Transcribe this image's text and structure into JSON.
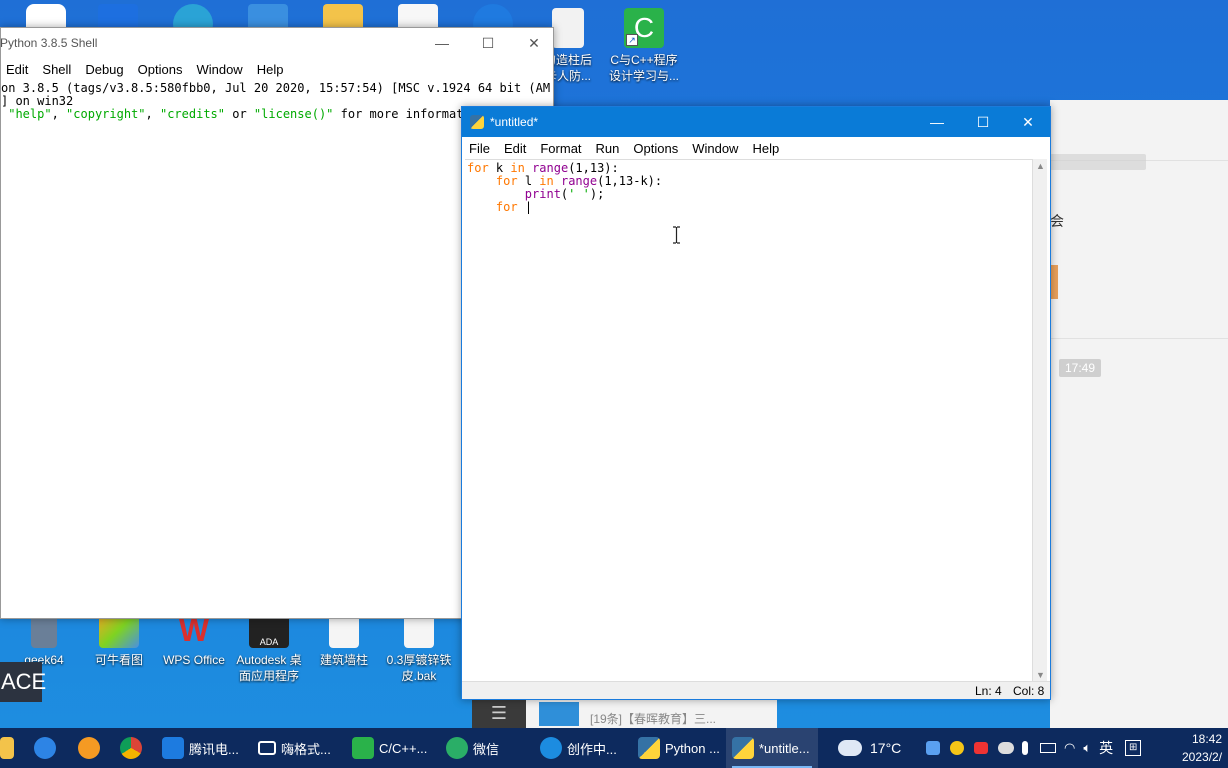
{
  "desktop": {
    "icons": [
      {
        "label": "勾造柱后",
        "label2": "卡人防...",
        "color": "#f2f2f2"
      },
      {
        "label": "C与C++程序",
        "label2": "设计学习与...",
        "color": "#2ab24a",
        "glyph": "C"
      },
      {
        "label": "geek64",
        "color": "#6a7f98"
      },
      {
        "label": "可牛看图",
        "color": "#f5a623"
      },
      {
        "label": "WPS Office",
        "color": "#d9302e",
        "glyph": "W"
      },
      {
        "label": "Autodesk 桌",
        "label2": "面应用程序",
        "color": "#222222",
        "glyph": "ADA"
      },
      {
        "label": "建筑墙柱",
        "color": "#f5f5f5"
      },
      {
        "label": "0.3厚镀锌铁",
        "label2": "皮.bak",
        "color": "#f5f5f5"
      }
    ],
    "ace_text": "ACE"
  },
  "background_app": {
    "chip1": "17:49",
    "text": "会",
    "bottom_text": "[19条]【春晖教育】三..."
  },
  "shell": {
    "title": "Python 3.8.5 Shell",
    "menu": [
      "Edit",
      "Shell",
      "Debug",
      "Options",
      "Window",
      "Help"
    ],
    "line1": "on 3.8.5 (tags/v3.8.5:580fbb0, Jul 20 2020, 15:57:54) [MSC v.1924 64 bit (AM",
    "line2": "] on win32",
    "line3_pre": " ",
    "line3_s1": "\"help\"",
    "line3_c1": ", ",
    "line3_s2": "\"copyright\"",
    "line3_c2": ", ",
    "line3_s3": "\"credits\"",
    "line3_c3": " or ",
    "line3_s4": "\"license()\"",
    "line3_post": " for more informati"
  },
  "editor": {
    "title": "*untitled*",
    "menu": [
      "File",
      "Edit",
      "Format",
      "Run",
      "Options",
      "Window",
      "Help"
    ],
    "code": {
      "l1_for": "for",
      "l1_a": " k ",
      "l1_in": "in",
      "l1_sp": " ",
      "l1_range": "range",
      "l1_b": "(1,13):",
      "l2_ind": "    ",
      "l2_for": "for",
      "l2_a": " l ",
      "l2_in": "in",
      "l2_sp": " ",
      "l2_range": "range",
      "l2_b": "(1,13-k):",
      "l3_ind": "        ",
      "l3_print": "print",
      "l3_a": "(",
      "l3_str": "' '",
      "l3_b": ");",
      "l4_ind": "    ",
      "l4_for": "for",
      "l4_a": " |"
    },
    "status_ln": "Ln: 4",
    "status_col": "Col: 8"
  },
  "taskbar": {
    "items": [
      {
        "label": "腾讯电...",
        "color": "#1d7be0"
      },
      {
        "label": "嗨格式...",
        "color": "#ffffff"
      },
      {
        "label": "C/C++...",
        "color": "#2ab24a"
      },
      {
        "label": "微信",
        "color": "#2aae67"
      },
      {
        "label": "创作中...",
        "color": "#1c8ce0"
      },
      {
        "label": "Python ...",
        "color": "#3572a5"
      },
      {
        "label": "*untitle...",
        "color": "#3572a5"
      }
    ],
    "weather": "17°C",
    "ime": "英",
    "time": "18:42",
    "date": "2023/2/"
  }
}
